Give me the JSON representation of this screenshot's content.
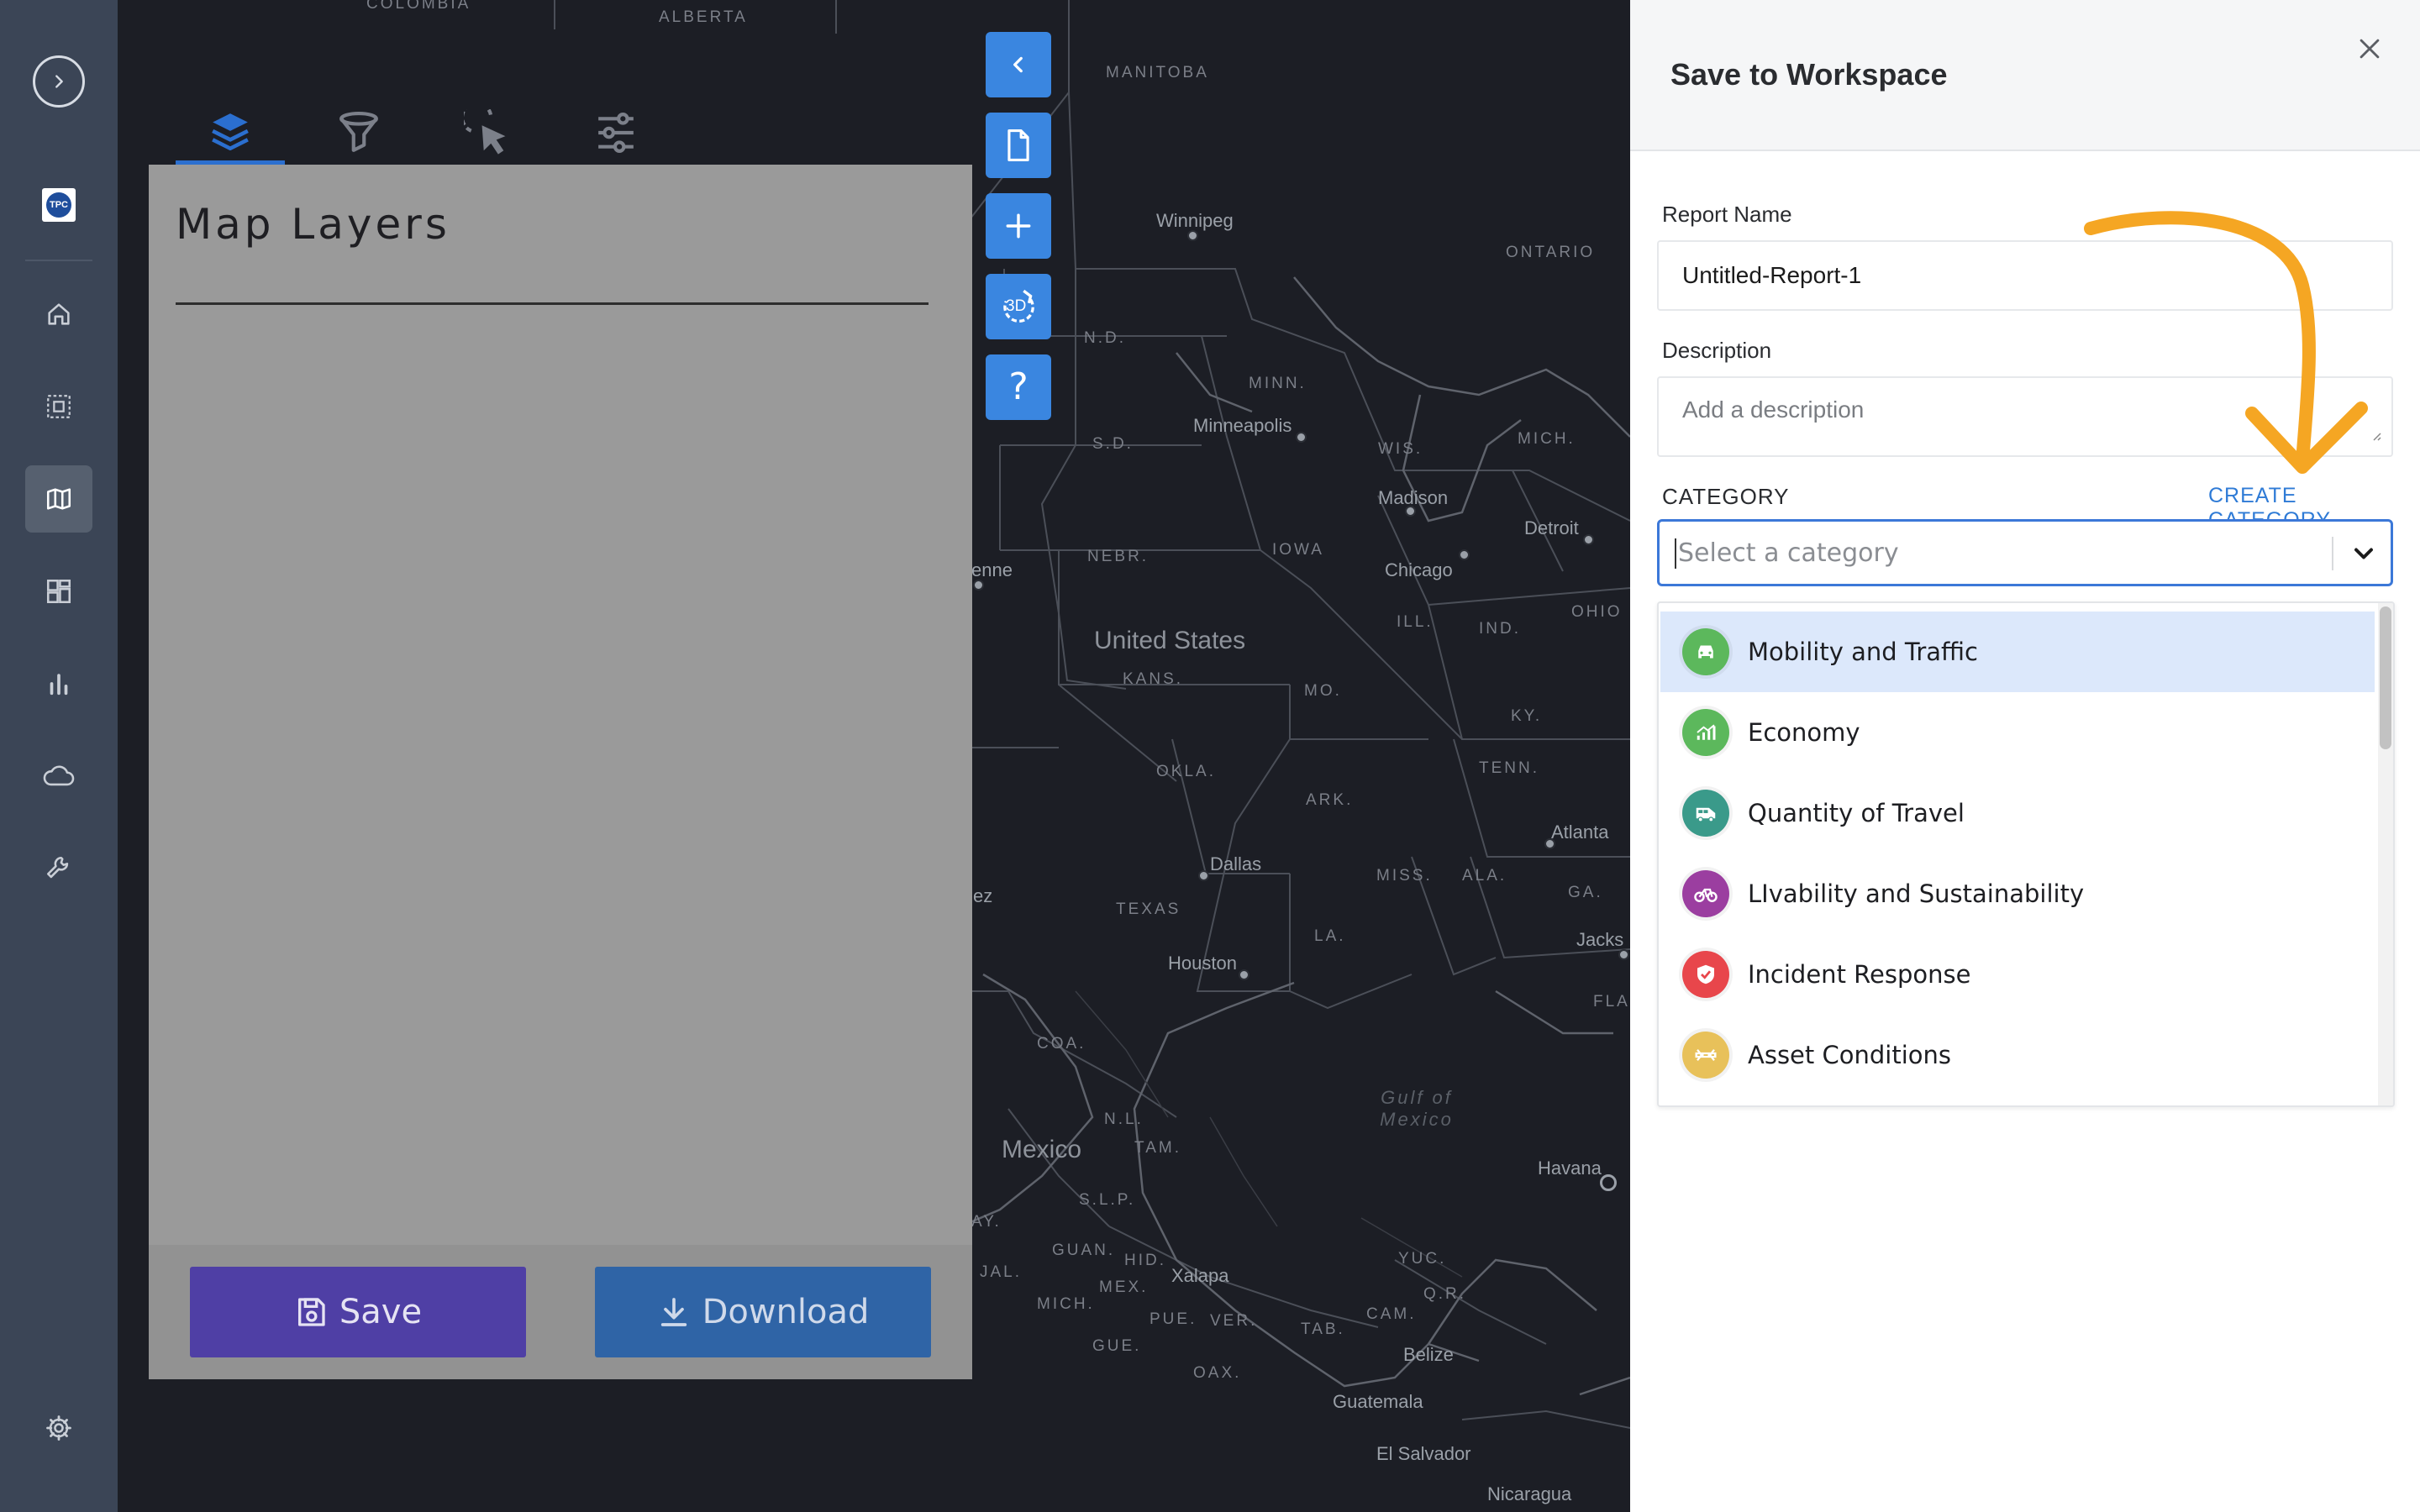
{
  "sidebar": {
    "items": [
      {
        "name": "sidebar-item-home",
        "icon": "home-icon"
      },
      {
        "name": "sidebar-item-selection",
        "icon": "selection-icon"
      },
      {
        "name": "sidebar-item-map",
        "icon": "map-icon",
        "active": true
      },
      {
        "name": "sidebar-item-dashboard",
        "icon": "dashboard-icon"
      },
      {
        "name": "sidebar-item-charts",
        "icon": "bar-chart-icon"
      },
      {
        "name": "sidebar-item-cloud",
        "icon": "cloud-icon"
      },
      {
        "name": "sidebar-item-tools",
        "icon": "wrench-icon"
      },
      {
        "name": "sidebar-item-settings",
        "icon": "gear-icon"
      }
    ],
    "logo_text": "TPC"
  },
  "map": {
    "labels": {
      "colombia": "COLOMBIA",
      "alberta": "ALBERTA",
      "manitoba": "MANITOBA",
      "ontario": "ONTARIO",
      "nd": "N.D.",
      "minn": "MINN.",
      "sd": "S.D.",
      "wis": "WIS.",
      "mich": "MICH.",
      "nebr": "NEBR.",
      "iowa": "IOWA",
      "ill": "ILL.",
      "ind": "IND.",
      "ohio": "OHIO",
      "kans": "KANS.",
      "mo": "MO.",
      "ky": "KY.",
      "tenn": "TENN.",
      "okla": "OKLA.",
      "ark": "ARK.",
      "miss": "MISS.",
      "ala": "ALA.",
      "ga": "GA.",
      "texas": "TEXAS",
      "la": "LA.",
      "fla": "FLA",
      "coa": "COA.",
      "nl": "N.L.",
      "tam": "TAM.",
      "slp": "S.L.P.",
      "ay": "AY.",
      "jal": "JAL.",
      "guan": "GUAN.",
      "hid": "HID.",
      "mex": "MEX.",
      "mich_mx": "MICH.",
      "pue": "PUE.",
      "ver": "VER.",
      "gue": "GUE.",
      "oax": "OAX.",
      "tab": "TAB.",
      "cam": "CAM.",
      "yuc": "YUC.",
      "qr": "Q.R."
    },
    "cities": {
      "winnipeg": "Winnipeg",
      "minneapolis": "Minneapolis",
      "madison": "Madison",
      "detroit": "Detroit",
      "chicago": "Chicago",
      "enne": "enne",
      "atlanta": "Atlanta",
      "dallas": "Dallas",
      "houston": "Houston",
      "jacks": "Jacks",
      "havana": "Havana",
      "xalapa": "Xalapa",
      "belize": "Belize",
      "guatemala": "Guatemala",
      "el_salvador": "El Salvador",
      "nicaragua": "Nicaragua",
      "ez": "ez"
    },
    "countries": {
      "us": "United States",
      "mexico": "Mexico"
    },
    "water": {
      "gulf": "Gulf of\nMexico"
    }
  },
  "layers_panel": {
    "tabs": [
      {
        "name": "tab-layers",
        "icon": "layers-icon",
        "active": true
      },
      {
        "name": "tab-filter",
        "icon": "funnel-icon"
      },
      {
        "name": "tab-select",
        "icon": "cursor-select-icon"
      },
      {
        "name": "tab-settings",
        "icon": "sliders-icon"
      }
    ],
    "title": "Map Layers",
    "save_label": "Save",
    "download_label": "Download"
  },
  "map_controls": [
    {
      "name": "collapse-panel-button",
      "icon": "chevron-left-icon"
    },
    {
      "name": "report-button",
      "icon": "document-icon"
    },
    {
      "name": "zoom-in-button",
      "icon": "plus-icon"
    },
    {
      "name": "3d-toggle-button",
      "icon": "3d-rotate-icon",
      "label": "3D"
    },
    {
      "name": "help-button",
      "icon": "question-icon"
    }
  ],
  "modal": {
    "title": "Save to Workspace",
    "report_name_label": "Report Name",
    "report_name_value": "Untitled-Report-1",
    "description_label": "Description",
    "description_placeholder": "Add a description",
    "category_label": "CATEGORY",
    "create_category_label": "CREATE CATEGORY",
    "category_placeholder": "Select a category",
    "options": [
      {
        "label": "Mobility and Traffic",
        "icon": "car-icon",
        "color": "#5cb85c",
        "highlighted": true
      },
      {
        "label": "Economy",
        "icon": "growth-chart-icon",
        "color": "#5cb85c"
      },
      {
        "label": "Quantity of Travel",
        "icon": "bus-icon",
        "color": "#3a9a8a"
      },
      {
        "label": "LIvability and Sustainability",
        "icon": "bicycle-icon",
        "color": "#9b3ea0"
      },
      {
        "label": "Incident Response",
        "icon": "shield-icon",
        "color": "#e8464b"
      },
      {
        "label": "Asset Conditions",
        "icon": "road-icon",
        "color": "#e8c15a"
      }
    ]
  },
  "colors": {
    "accent": "#3c78d8",
    "sidebar": "#3b4556",
    "save_button": "#4f3fa5",
    "download_button": "#2f64a6",
    "map_control": "#3a86e0",
    "annotation_arrow": "#f5a623"
  }
}
